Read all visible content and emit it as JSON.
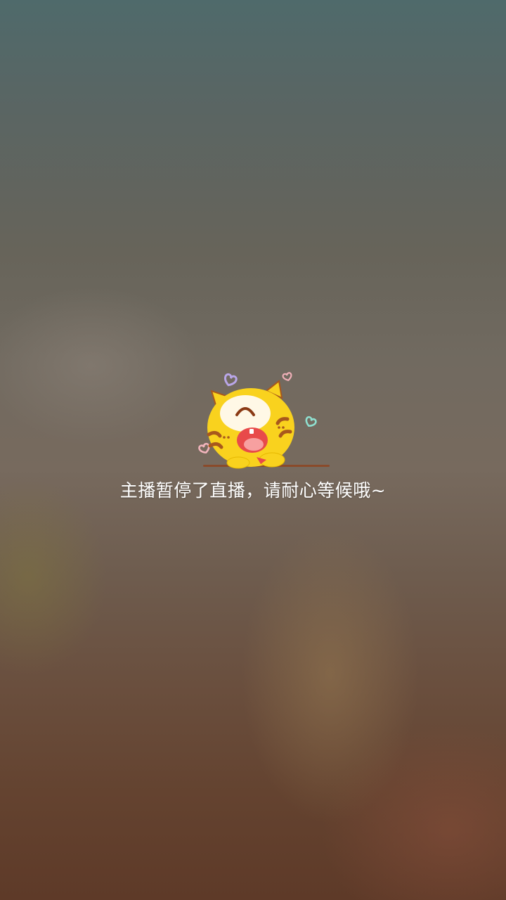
{
  "stream_status": {
    "mascot_icon": "sleepy-cat-mascot-icon",
    "message": "主播暂停了直播，请耐心等候哦~"
  },
  "colors": {
    "mascot_yellow": "#f9d21e",
    "mascot_stripe": "#a8581c",
    "message_text": "#ffffff"
  }
}
